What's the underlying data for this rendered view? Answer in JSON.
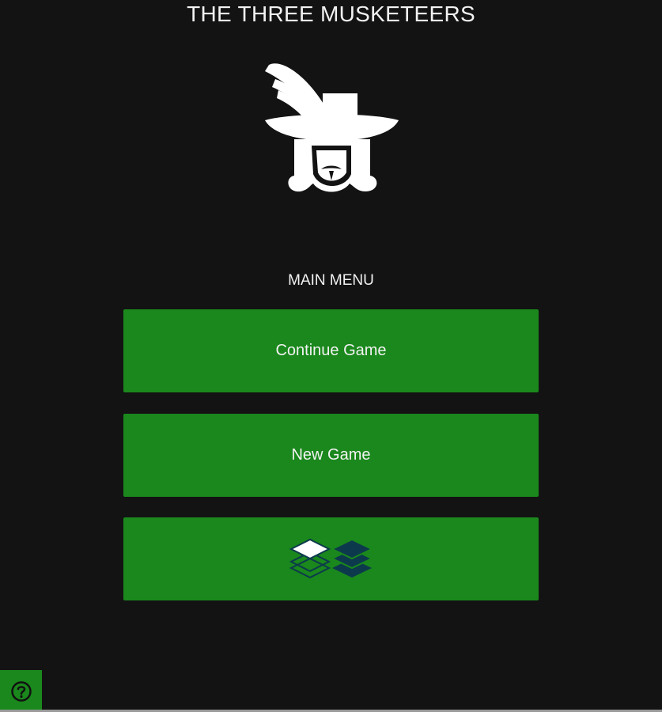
{
  "app": {
    "title": "THE THREE MUSKETEERS"
  },
  "menu": {
    "heading": "MAIN MENU",
    "buttons": [
      {
        "label": "Continue Game"
      },
      {
        "label": "New Game"
      },
      {
        "label": "",
        "icon": "theme-layers-icon"
      }
    ]
  },
  "help": {
    "icon": "help-circle-icon"
  },
  "colors": {
    "background": "#131313",
    "button": "#1a881c",
    "text": "#f2f2f2",
    "layer_dark": "#0c3a4c",
    "layer_light": "#ffffff"
  }
}
